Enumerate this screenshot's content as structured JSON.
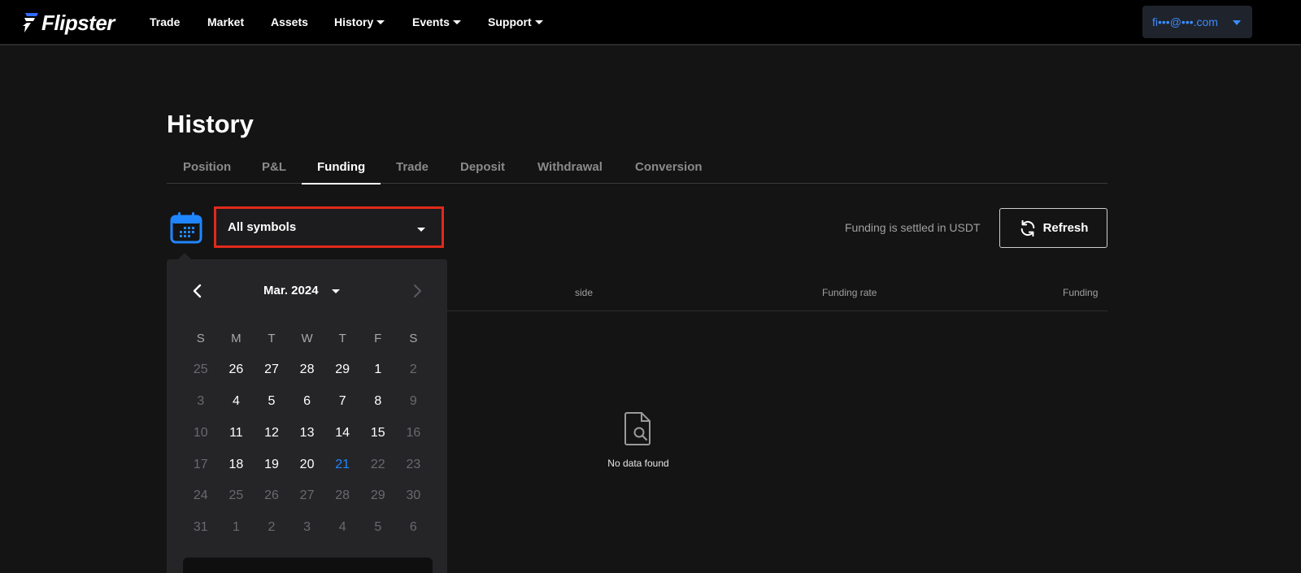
{
  "nav": {
    "logo_text": "Flipster",
    "items": [
      {
        "label": "Trade",
        "dropdown": false
      },
      {
        "label": "Market",
        "dropdown": false
      },
      {
        "label": "Assets",
        "dropdown": false
      },
      {
        "label": "History",
        "dropdown": true
      },
      {
        "label": "Events",
        "dropdown": true
      },
      {
        "label": "Support",
        "dropdown": true
      }
    ],
    "account_email": "fi•••@•••.com"
  },
  "page": {
    "title": "History",
    "tabs": [
      "Position",
      "P&L",
      "Funding",
      "Trade",
      "Deposit",
      "Withdrawal",
      "Conversion"
    ],
    "active_tab": "Funding"
  },
  "filters": {
    "symbol_select_value": "All symbols",
    "settled_note": "Funding is settled in USDT",
    "refresh_label": "Refresh"
  },
  "table": {
    "columns": [
      "side",
      "Funding rate",
      "Funding"
    ],
    "empty_text": "No data found"
  },
  "calendar": {
    "month_label": "Mar. 2024",
    "weekdays": [
      "S",
      "M",
      "T",
      "W",
      "T",
      "F",
      "S"
    ],
    "weeks": [
      [
        {
          "d": "25",
          "state": "muted"
        },
        {
          "d": "26",
          "state": "normal"
        },
        {
          "d": "27",
          "state": "normal"
        },
        {
          "d": "28",
          "state": "normal"
        },
        {
          "d": "29",
          "state": "normal"
        },
        {
          "d": "1",
          "state": "normal"
        },
        {
          "d": "2",
          "state": "muted"
        }
      ],
      [
        {
          "d": "3",
          "state": "muted"
        },
        {
          "d": "4",
          "state": "normal"
        },
        {
          "d": "5",
          "state": "normal"
        },
        {
          "d": "6",
          "state": "normal"
        },
        {
          "d": "7",
          "state": "normal"
        },
        {
          "d": "8",
          "state": "normal"
        },
        {
          "d": "9",
          "state": "muted"
        }
      ],
      [
        {
          "d": "10",
          "state": "muted"
        },
        {
          "d": "11",
          "state": "normal"
        },
        {
          "d": "12",
          "state": "normal"
        },
        {
          "d": "13",
          "state": "normal"
        },
        {
          "d": "14",
          "state": "normal"
        },
        {
          "d": "15",
          "state": "normal"
        },
        {
          "d": "16",
          "state": "muted"
        }
      ],
      [
        {
          "d": "17",
          "state": "muted"
        },
        {
          "d": "18",
          "state": "normal"
        },
        {
          "d": "19",
          "state": "normal"
        },
        {
          "d": "20",
          "state": "normal"
        },
        {
          "d": "21",
          "state": "today"
        },
        {
          "d": "22",
          "state": "muted"
        },
        {
          "d": "23",
          "state": "muted"
        }
      ],
      [
        {
          "d": "24",
          "state": "muted"
        },
        {
          "d": "25",
          "state": "muted"
        },
        {
          "d": "26",
          "state": "muted"
        },
        {
          "d": "27",
          "state": "muted"
        },
        {
          "d": "28",
          "state": "muted"
        },
        {
          "d": "29",
          "state": "muted"
        },
        {
          "d": "30",
          "state": "muted"
        }
      ],
      [
        {
          "d": "31",
          "state": "muted"
        },
        {
          "d": "1",
          "state": "muted"
        },
        {
          "d": "2",
          "state": "muted"
        },
        {
          "d": "3",
          "state": "muted"
        },
        {
          "d": "4",
          "state": "muted"
        },
        {
          "d": "5",
          "state": "muted"
        },
        {
          "d": "6",
          "state": "muted"
        }
      ]
    ]
  },
  "colors": {
    "accent_blue": "#1f86ff",
    "highlight_red": "#e0291a",
    "background": "#141414"
  },
  "icons": {
    "logo": "flipster-bolt-icon",
    "calendar": "calendar-icon",
    "refresh": "refresh-icon",
    "empty": "document-search-icon"
  }
}
